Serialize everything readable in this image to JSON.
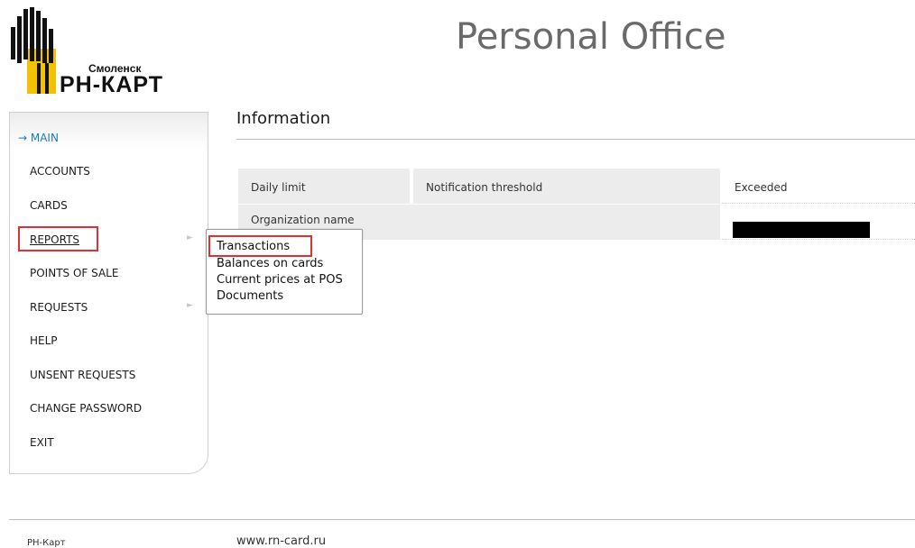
{
  "header": {
    "logo_city": "Смоленск",
    "logo_brand": "РН-КАРТ",
    "title": "Personal Office"
  },
  "sidebar": {
    "items": [
      {
        "label": "→ MAIN",
        "active": true
      },
      {
        "label": "ACCOUNTS"
      },
      {
        "label": "CARDS"
      },
      {
        "label": "REPORTS",
        "has_submenu": true
      },
      {
        "label": "POINTS OF SALE"
      },
      {
        "label": "REQUESTS",
        "has_submenu": true
      },
      {
        "label": "HELP"
      },
      {
        "label": "UNSENT REQUESTS"
      },
      {
        "label": "CHANGE PASSWORD"
      },
      {
        "label": "EXIT"
      }
    ],
    "submenu_arrow": "►"
  },
  "reports_menu": {
    "items": [
      "Transactions",
      "Balances on cards",
      "Current prices at POS",
      "Documents"
    ]
  },
  "main": {
    "section_title": "Information",
    "table": {
      "row1": [
        "Daily limit",
        "Notification threshold",
        "Exceeded"
      ],
      "row2_label": "Organization name"
    }
  },
  "footer": {
    "left": "РН-Карт",
    "url": "www.rn-card.ru"
  },
  "colors": {
    "accent": "#1a7abf",
    "highlight": "#e03131",
    "logo_yellow": "#f2c200"
  }
}
